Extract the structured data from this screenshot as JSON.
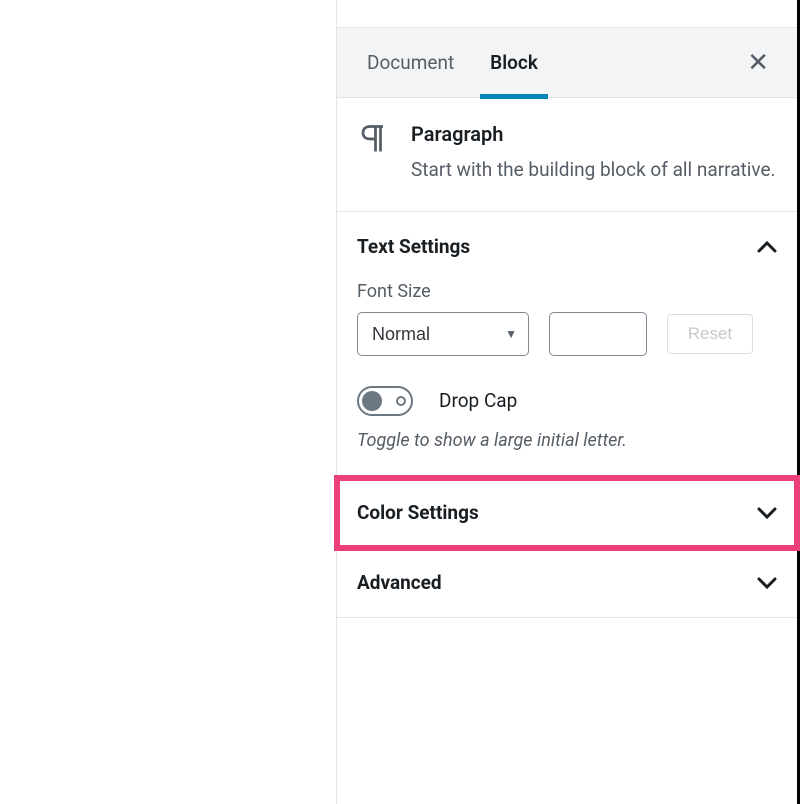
{
  "tabs": {
    "document": "Document",
    "block": "Block"
  },
  "blockInfo": {
    "title": "Paragraph",
    "description": "Start with the building block of all narrative."
  },
  "panels": {
    "textSettings": {
      "title": "Text Settings",
      "fontSizeLabel": "Font Size",
      "fontSizeValue": "Normal",
      "resetLabel": "Reset",
      "dropCapLabel": "Drop Cap",
      "dropCapHelp": "Toggle to show a large initial letter."
    },
    "colorSettings": {
      "title": "Color Settings"
    },
    "advanced": {
      "title": "Advanced"
    }
  }
}
